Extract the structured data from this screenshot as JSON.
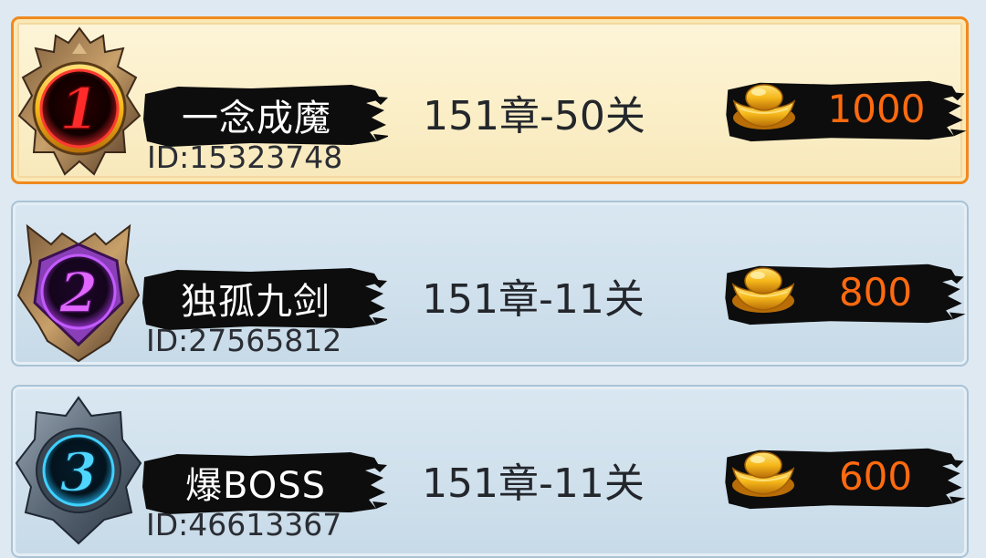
{
  "leaderboard": {
    "rows": [
      {
        "rank": "1",
        "name": "一念成魔",
        "id": "ID:15323748",
        "progress": "151章-50关",
        "reward": "1000"
      },
      {
        "rank": "2",
        "name": "独孤九剑",
        "id": "ID:27565812",
        "progress": "151章-11关",
        "reward": "800"
      },
      {
        "rank": "3",
        "name": "爆BOSS",
        "id": "ID:46613367",
        "progress": "151章-11关",
        "reward": "600"
      }
    ]
  },
  "colors": {
    "highlight_border": "#f08a1e",
    "reward_text": "#ff6a0f",
    "rank1_glow": "#e3262b",
    "rank2_glow": "#b43cf0",
    "rank3_glow": "#23b8f2",
    "gold": "#f6b81b"
  },
  "icons": {
    "rank1": "gold-crest-rank-1-icon",
    "rank2": "purple-crest-rank-2-icon",
    "rank3": "blue-crest-rank-3-icon",
    "reward": "gold-ingot-icon"
  }
}
